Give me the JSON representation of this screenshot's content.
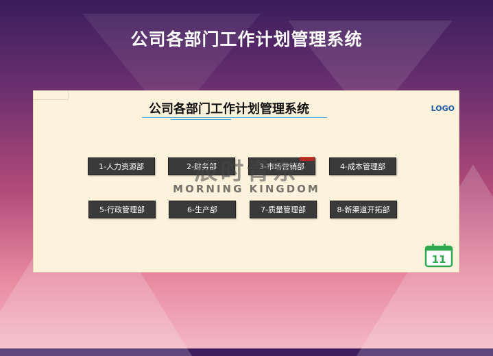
{
  "slide": {
    "title": "公司各部门工作计划管理系统"
  },
  "sheet": {
    "title": "公司各部门工作计划管理系统",
    "logo": "LOGO",
    "departments": [
      "1-人力资源部",
      "2-财务部",
      "3-市场营销部",
      "4-成本管理部",
      "5-行政管理部",
      "6-生产部",
      "7-质量管理部",
      "8-新渠道开拓部"
    ],
    "watermark": {
      "cn": "辰时青东",
      "en": "MORNING KINGDOM"
    },
    "calendar_day": "11"
  },
  "colors": {
    "sheet_bg": "#fdf2dc",
    "button_bg": "#3a3a3a",
    "logo": "#1f5fa8",
    "calendar_green": "#2fa84f",
    "underline": "#4aa3d6"
  },
  "icons": [
    "calendar-icon"
  ]
}
